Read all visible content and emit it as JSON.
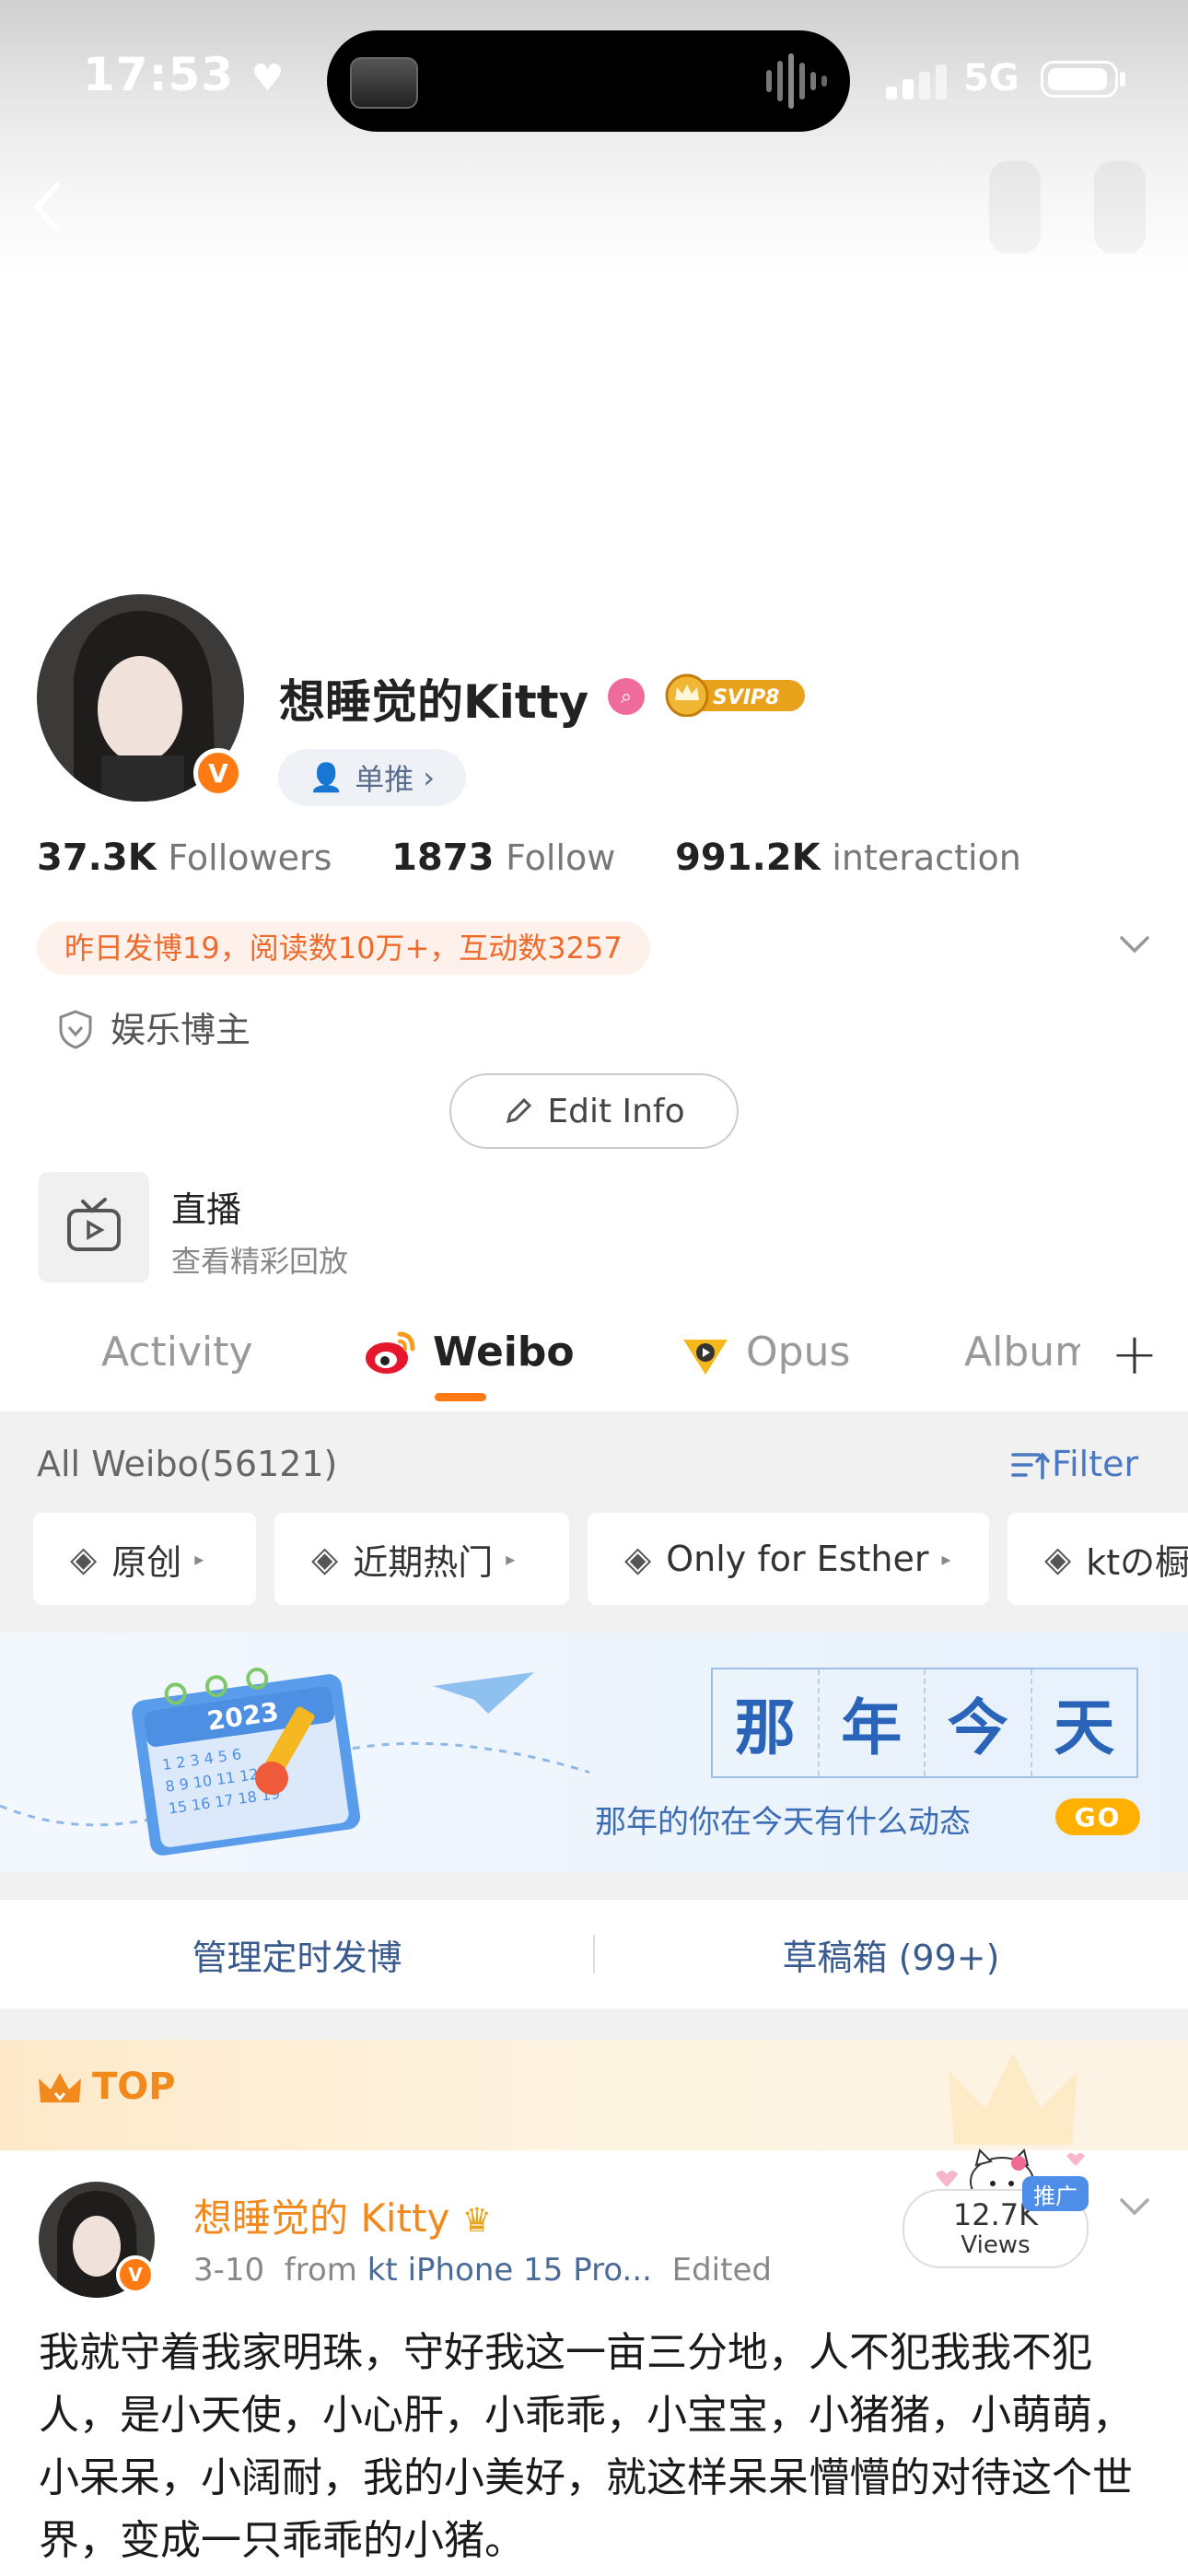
{
  "status_bar": {
    "time": "17:53",
    "network": "5G"
  },
  "profile": {
    "name": "想睡觉的Kitty",
    "svip": "SVIP8",
    "tag_pill": "单推",
    "stats": [
      {
        "value": "37.3K",
        "label": "Followers"
      },
      {
        "value": "1873",
        "label": "Follow"
      },
      {
        "value": "991.2K",
        "label": "interaction"
      }
    ],
    "notice": "昨日发博19，阅读数10万+，互动数3257",
    "category": "娱乐博主",
    "edit_label": "Edit Info",
    "live_title": "直播",
    "live_subtitle": "查看精彩回放"
  },
  "tabs": [
    {
      "label": "Activity"
    },
    {
      "label": "Weibo"
    },
    {
      "label": "Opus"
    },
    {
      "label": "Album"
    }
  ],
  "weibo_list": {
    "all_label": "All Weibo(56121)",
    "filter_label": "Filter",
    "chips": [
      "原创",
      "近期热门",
      "Only for Esther",
      "ktの橱"
    ]
  },
  "banner": {
    "chars": [
      "那",
      "年",
      "今",
      "天"
    ],
    "calendar_year": "2023",
    "subtitle": "那年的你在今天有什么动态",
    "go_label": "GO"
  },
  "actions": {
    "manage": "管理定时发博",
    "drafts": "草稿箱 (99+)"
  },
  "pinned": {
    "label": "TOP"
  },
  "post": {
    "author": "想睡觉的 Kitty",
    "date": "3-10",
    "from_prefix": "from",
    "source": "kt iPhone 15 Pro...",
    "edited": "Edited",
    "views_count": "12.7K",
    "views_label": "Views",
    "promo": "推广",
    "text": "我就守着我家明珠，守好我这一亩三分地，人不犯我我不犯人，是小天使，小心肝，小乖乖，小宝宝，小猪猪，小萌萌，小呆呆，小阔耐，我的小美好，就这样呆呆懵懵的对待这个世界，变成一只乖乖的小猪。"
  },
  "colors": {
    "accent": "#ff7a12",
    "link": "#4a78c2",
    "pinned": "#f2891c"
  }
}
